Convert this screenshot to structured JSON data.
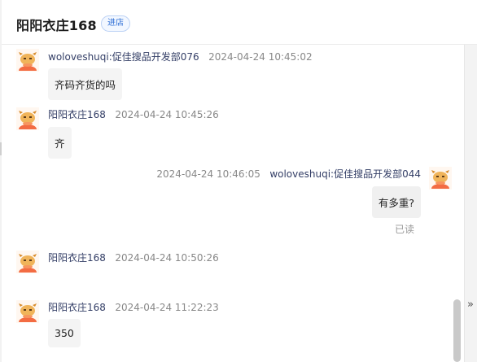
{
  "header": {
    "shop_name": "阳阳衣庄168",
    "enter_shop_label": "进店"
  },
  "messages": [
    {
      "sender": "woloveshuqi:促佳搜品开发部076",
      "time": "2024-04-24 10:45:02",
      "text": "齐码齐货的吗",
      "side": "left"
    },
    {
      "sender": "阳阳衣庄168",
      "time": "2024-04-24 10:45:26",
      "text": "齐",
      "side": "left"
    },
    {
      "sender": "woloveshuqi:促佳搜品开发部044",
      "time": "2024-04-24 10:46:05",
      "text": "有多重?",
      "side": "right",
      "status": "已读"
    },
    {
      "sender": "阳阳衣庄168",
      "time": "2024-04-24 10:50:26",
      "text": "",
      "side": "left"
    },
    {
      "sender": "阳阳衣庄168",
      "time": "2024-04-24 11:22:23",
      "text": "350",
      "side": "left"
    }
  ],
  "icons": {
    "avatar": "cartoon-avatar-icon",
    "expand": "chevron-double-right-icon"
  },
  "colors": {
    "sender_name": "#333e66",
    "enter_shop_text": "#2f6fd6",
    "bubble_bg": "#f4f4f4",
    "avatar_orange": "#f36c43"
  }
}
